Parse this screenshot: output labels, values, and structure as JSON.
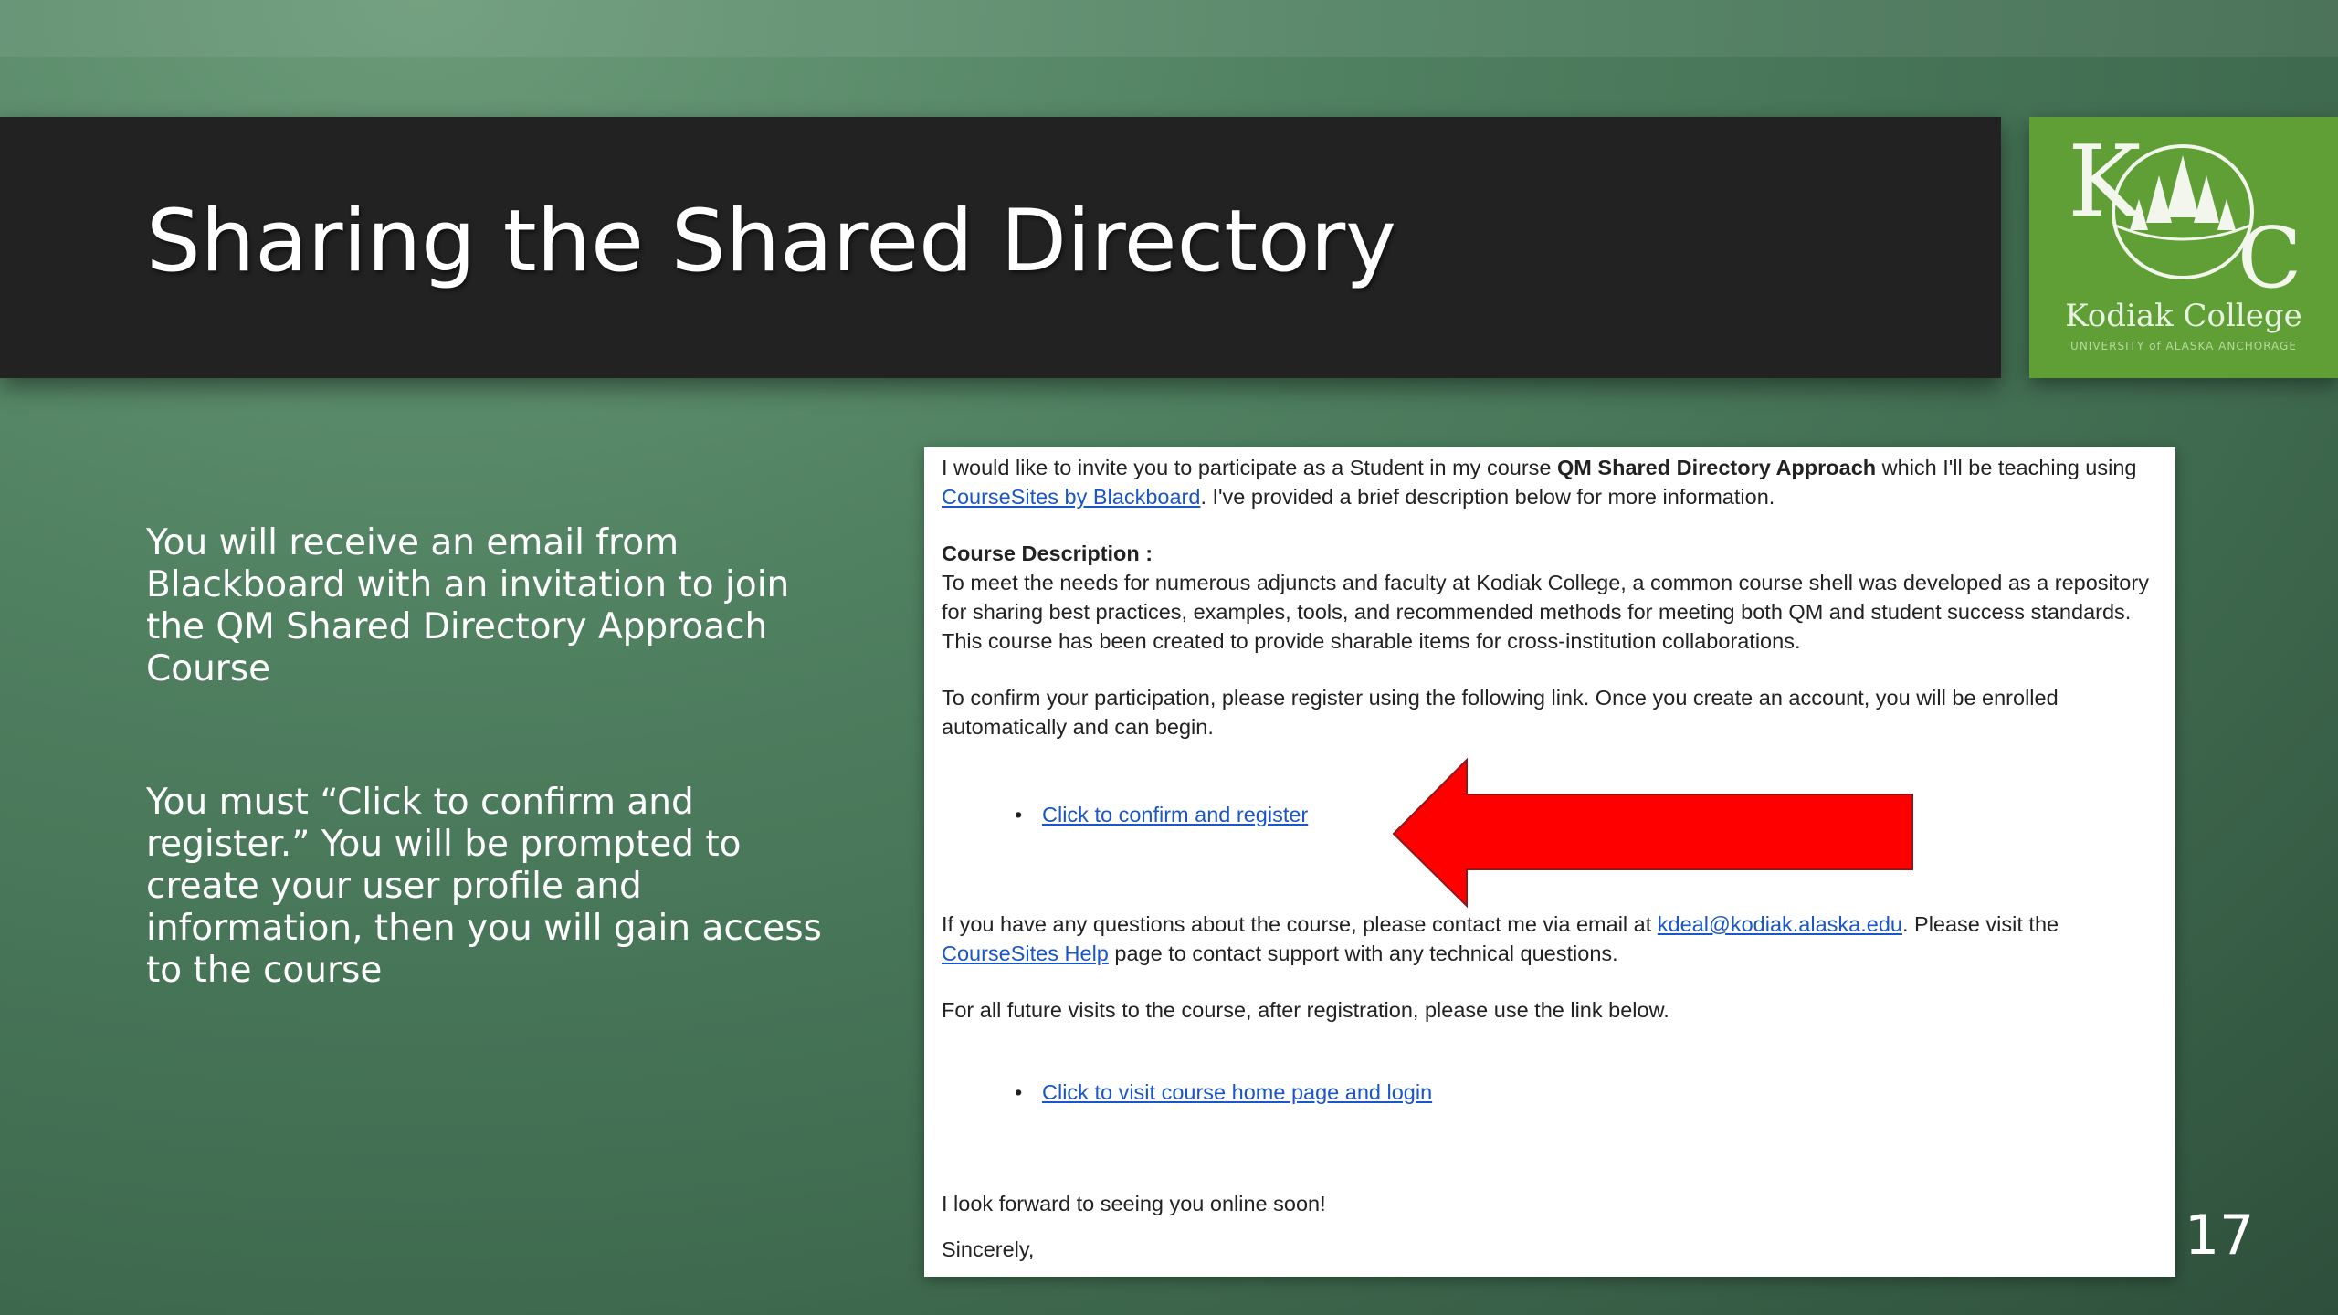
{
  "slide": {
    "title": "Sharing the Shared Directory",
    "number": "17"
  },
  "logo": {
    "initials": "KC",
    "name": "Kodiak College",
    "subtitle": "UNIVERSITY of ALASKA ANCHORAGE"
  },
  "body": {
    "paragraph1": "You will receive an email from Blackboard with an invitation to join the QM Shared Directory Approach Course",
    "paragraph2": "You must “Click to confirm and register.” You will be prompted to create your user profile and information, then you will gain access to the course"
  },
  "email": {
    "intro_part1": "I would like to invite you to participate as a Student in my course ",
    "intro_course": "QM Shared Directory Approach",
    "intro_part2": " which I'll be teaching using ",
    "coursesites_link": "CourseSites by Blackboard",
    "intro_part3": ". I've provided a brief description below for more information.",
    "description_heading": "Course Description :",
    "description_text": "To meet the needs for numerous adjuncts and faculty at Kodiak College, a common course shell was developed as a repository for sharing best practices, examples, tools, and recommended methods for meeting both QM and student success standards. This course has been created to provide sharable items for cross-institution collaborations.",
    "confirm_text": "To confirm your participation, please register using the following link. Once you create an account, you will be enrolled automatically and can begin.",
    "confirm_link": "Click to confirm and register",
    "questions_part1": "If you have any questions about the course, please contact me via email at ",
    "email_link": "kdeal@kodiak.alaska.edu",
    "questions_part2": ". Please visit the ",
    "help_link": "CourseSites Help",
    "questions_part3": " page to contact support with any technical questions.",
    "future_text": "For all future visits to the course, after registration, please use the link below.",
    "visit_link": "Click to visit course home page and login",
    "closing": "I look forward to seeing you online soon!",
    "signature_partial": "Sincerely,"
  },
  "colors": {
    "title_bar": "#222222",
    "logo_green": "#5f9f36",
    "arrow_red": "#ff0000",
    "link_blue": "#1a56c9"
  },
  "icons": {
    "arrow": "left-arrow-icon",
    "logo_tree": "tree-icon"
  }
}
